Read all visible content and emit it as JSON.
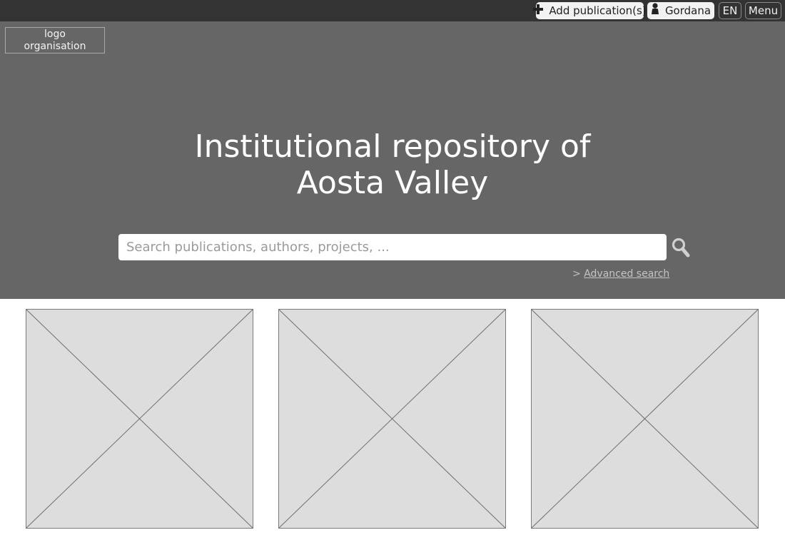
{
  "topbar": {
    "add_label": "Add publication(s)",
    "add_icon": "plus-icon",
    "user_label": "Gordana",
    "user_icon": "user-icon",
    "lang_label": "EN",
    "menu_label": "Menu"
  },
  "hero": {
    "logo_text": "logo\norganisation",
    "title": "Institutional repository of\nAosta Valley",
    "search_placeholder": "Search publications, authors, projects, ...",
    "search_icon": "search-icon",
    "advanced_prefix": "> ",
    "advanced_label": "Advanced search"
  },
  "images": [
    {
      "kind": "image-placeholder"
    },
    {
      "kind": "image-placeholder"
    },
    {
      "kind": "image-placeholder"
    }
  ],
  "colors": {
    "topbar": "#333333",
    "hero": "#666666",
    "placeholder_fill": "#dddddd"
  }
}
